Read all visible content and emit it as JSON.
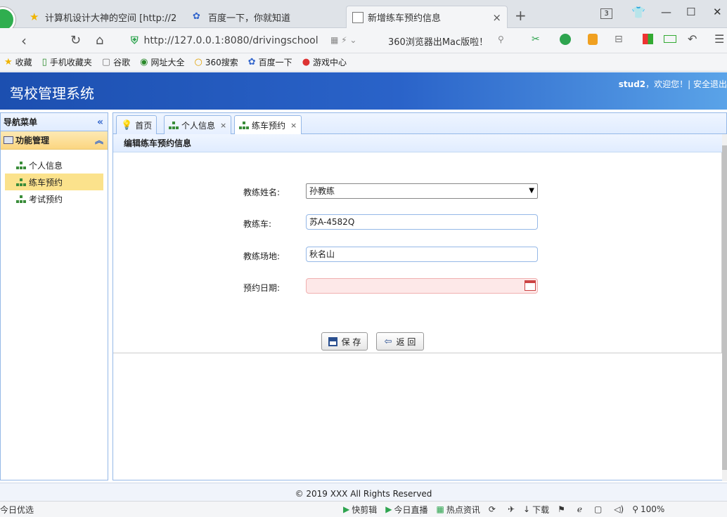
{
  "browser": {
    "tabs": [
      {
        "title": "计算机设计大神的空间 [http://2",
        "icon": "star-icon"
      },
      {
        "title": "百度一下，你就知道",
        "icon": "paw-icon"
      },
      {
        "title": "新增练车预约信息",
        "icon": "page-icon",
        "close": "×"
      }
    ],
    "new_tab": "+",
    "tab_count": "3",
    "url": "http://127.0.0.1:8080/drivingschool",
    "promo": "360浏览器出Mac版啦！",
    "bookmarks": [
      "收藏",
      "手机收藏夹",
      "谷歌",
      "网址大全",
      "360搜索",
      "百度一下",
      "游戏中心"
    ],
    "window_controls": {
      "minimize": "—",
      "maximize": "☐",
      "close": "✕"
    }
  },
  "app": {
    "title": "驾校管理系统",
    "user": "stud2",
    "welcome": "，欢迎您！| 安全退出",
    "header_gradient": "#1c4fb0"
  },
  "sidebar": {
    "header": "导航菜单",
    "collapse": "«",
    "group": "功能管理",
    "group_toggle": "︽",
    "items": [
      {
        "label": "个人信息",
        "selected": false
      },
      {
        "label": "练车预约",
        "selected": true
      },
      {
        "label": "考试预约",
        "selected": false
      }
    ]
  },
  "main": {
    "tabs": [
      {
        "label": "首页",
        "closable": false
      },
      {
        "label": "个人信息",
        "closable": true
      },
      {
        "label": "练车预约",
        "closable": true,
        "active": true
      }
    ],
    "tab_close": "×",
    "form": {
      "title": "编辑练车预约信息",
      "fields": [
        {
          "label": "教练姓名:",
          "value": "孙教练",
          "type": "select"
        },
        {
          "label": "教练车:",
          "value": "苏A-4582Q",
          "type": "text"
        },
        {
          "label": "教练场地:",
          "value": "秋名山",
          "type": "text"
        },
        {
          "label": "预约日期:",
          "value": "",
          "type": "date",
          "required": true
        }
      ],
      "save": "保 存",
      "back": "返 回"
    }
  },
  "footer": {
    "text": "© 2019 XXX All Rights Reserved"
  },
  "statusbar": {
    "items": [
      "今日优选",
      "快剪辑",
      "今日直播",
      "热点资讯",
      "下载"
    ],
    "zoom": "100%"
  }
}
